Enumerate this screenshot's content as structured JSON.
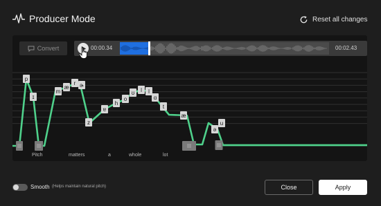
{
  "header": {
    "title": "Producer Mode",
    "title_icon": "waveform-icon",
    "reset_label": "Reset all changes",
    "reset_icon": "refresh-icon"
  },
  "toolbar": {
    "convert_label": "Convert",
    "convert_icon": "speech-bubble-icon",
    "play_icon": "play-icon",
    "time_current": "00:00.34",
    "time_total": "00:02.43",
    "playback_progress": 0.14,
    "selection_color": "#1f6fe0"
  },
  "pitch_editor": {
    "line_color": "#4fd18b",
    "phonemes": [
      "p",
      "ɪ",
      "tʃ",
      "m",
      "æ",
      "r",
      "ɚ",
      "z",
      "ɐ",
      "h",
      "o",
      "ʊ",
      "l",
      "l",
      "ɑ",
      "t",
      "æ",
      "u",
      "ə"
    ],
    "words": [
      "Pitch",
      "matters",
      "a",
      "whole",
      "lot"
    ]
  },
  "footer": {
    "smooth_label": "Smooth",
    "smooth_hint": "(Helps maintain natural pitch)",
    "smooth_enabled": false,
    "close_label": "Close",
    "apply_label": "Apply"
  }
}
